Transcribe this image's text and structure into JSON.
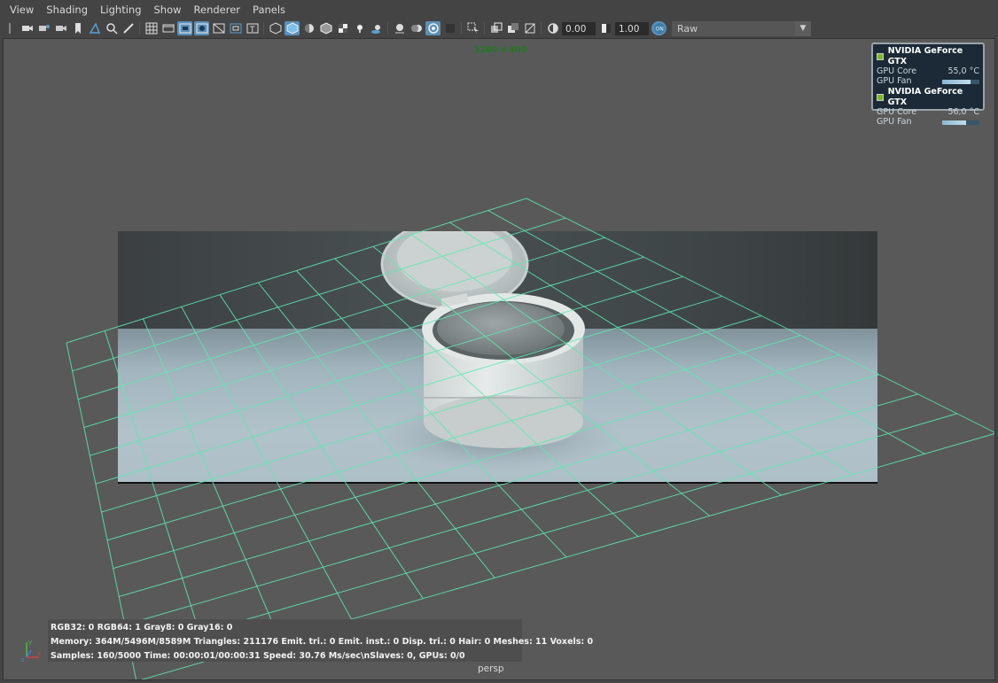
{
  "menu": {
    "items": [
      "View",
      "Shading",
      "Lighting",
      "Show",
      "Renderer",
      "Panels"
    ]
  },
  "toolbar": {
    "exposure_value": "0.00",
    "gamma_value": "1.00",
    "color_space": "Raw",
    "icons": [
      "select-camera-icon",
      "camera-attr-icon",
      "bookmark-icon",
      "image-plane-icon",
      "2d-pan-icon",
      "grease-pencil-icon",
      "grid-icon",
      "film-gate-icon",
      "resolution-gate-icon",
      "gate-mask-icon",
      "field-chart-icon",
      "safe-action-icon",
      "safe-title-icon",
      "wireframe-icon",
      "smooth-shade-icon",
      "default-material-icon",
      "wireframe-on-shaded-icon",
      "textured-icon",
      "use-lights-icon",
      "shadows-icon",
      "screen-space-ao-icon",
      "motion-blur-icon",
      "anti-aliasing-icon",
      "depth-of-field-icon",
      "isolate-select-icon",
      "xray-icon",
      "xray-joints-icon",
      "xray-components-icon",
      "exposure-icon",
      "gamma-icon",
      "color-management-icon"
    ]
  },
  "viewport": {
    "resolution_label": "1200 x 400",
    "camera_label": "persp",
    "grid_color": "#5fe8b0"
  },
  "gpu_monitor": {
    "gpus": [
      {
        "name": "NVIDIA GeForce GTX",
        "core_label": "GPU Core",
        "core_temp": "55,0 °C",
        "fan_label": "GPU Fan",
        "fan_level": 0.75
      },
      {
        "name": "NVIDIA GeForce GTX",
        "core_label": "GPU Core",
        "core_temp": "56,0 °C",
        "fan_label": "GPU Fan",
        "fan_level": 0.65
      }
    ]
  },
  "render_stats": {
    "line1": "RGB32: 0 RGB64: 1 Gray8: 0 Gray16: 0",
    "line2": "Memory: 364M/5496M/8589M Triangles: 211176 Emit. tri.: 0 Emit. inst.: 0 Disp. tri.: 0 Hair: 0 Meshes: 11 Voxels: 0",
    "line3": "Samples: 160/5000 Time: 00:00:01/00:00:31 Speed: 30.76 Ms/sec\\nSlaves: 0, GPUs: 0/0"
  }
}
